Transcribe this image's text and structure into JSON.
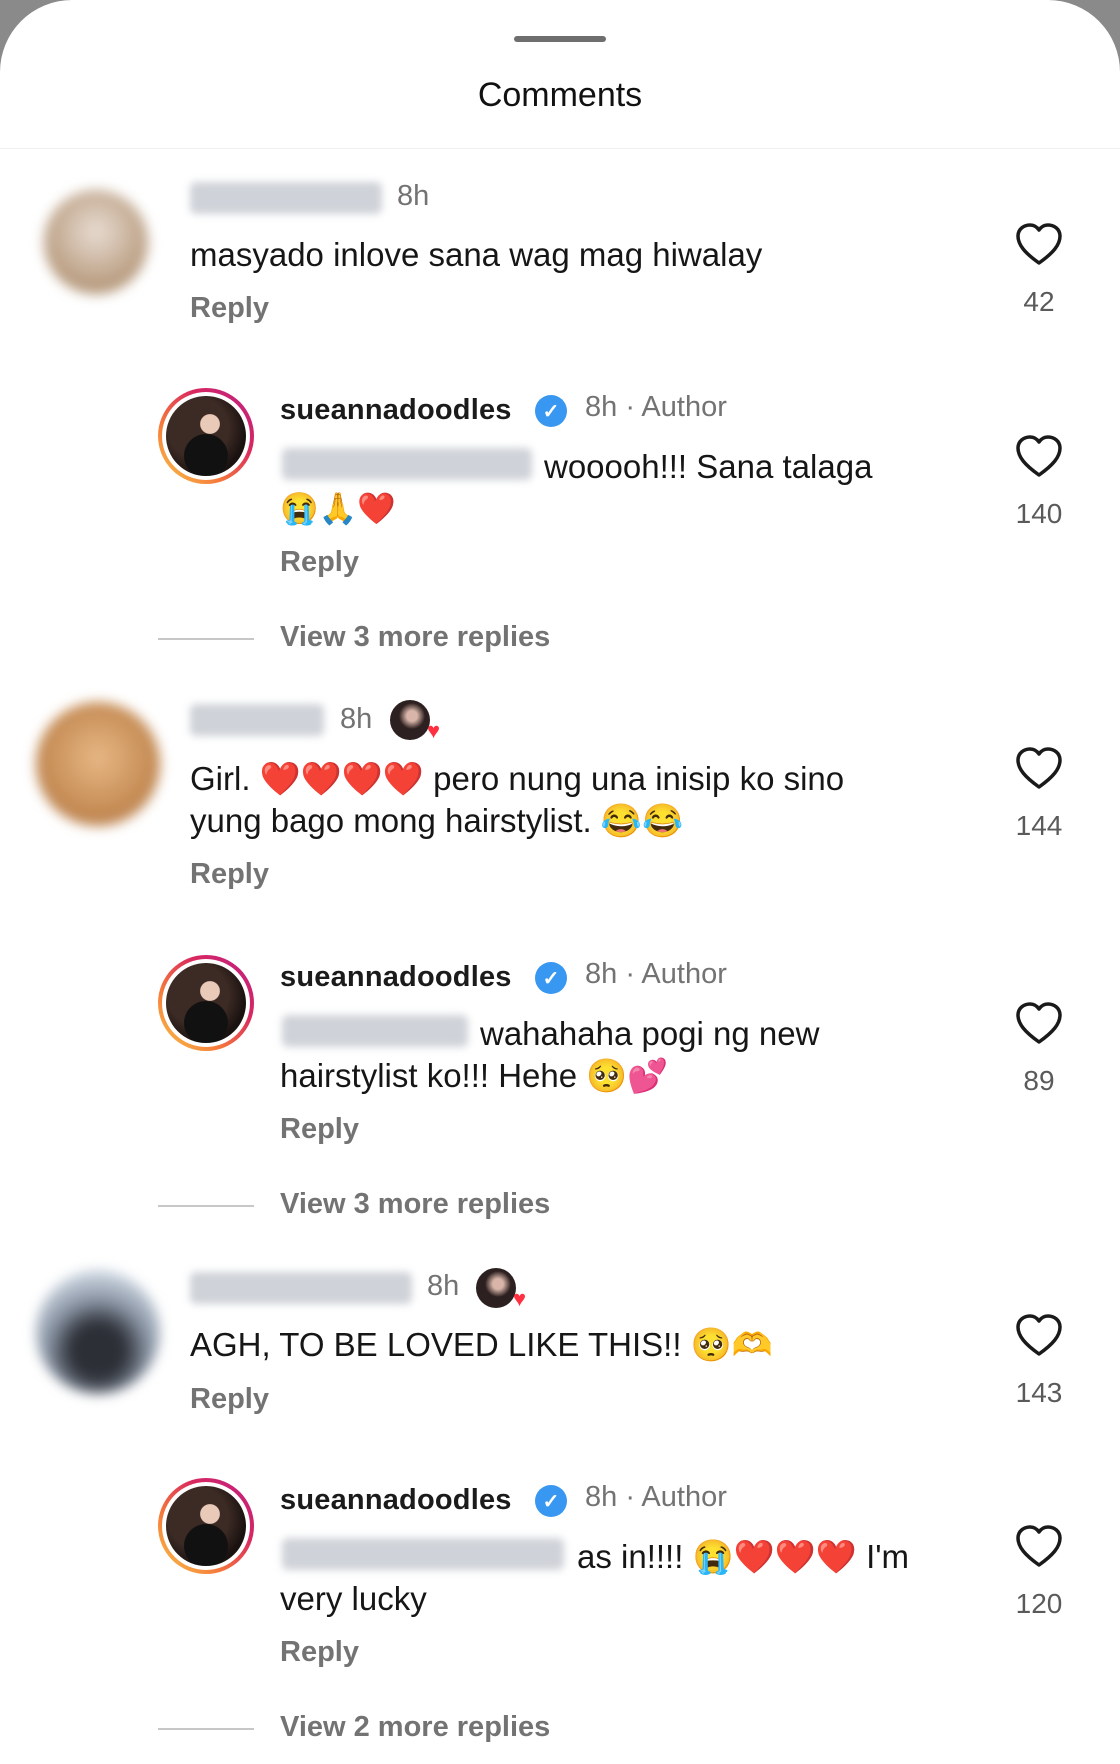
{
  "sheet": {
    "title": "Comments"
  },
  "comments": [
    {
      "time": "8h",
      "text": "masyado inlove sana wag mag hiwalay",
      "reply": "Reply",
      "likes": "42"
    },
    {
      "author": "sueannadoodles",
      "time": "8h · Author",
      "text_line1": "wooooh!!! Sana talaga",
      "text_line2": "😭🙏❤️",
      "reply": "Reply",
      "likes": "140",
      "view_more": "View 3 more replies"
    },
    {
      "time": "8h",
      "text_line1": "Girl. ❤️❤️❤️❤️ pero nung una inisip ko sino",
      "text_line2": "yung bago mong hairstylist. 😂😂",
      "reply": "Reply",
      "likes": "144"
    },
    {
      "author": "sueannadoodles",
      "time": "8h · Author",
      "text_line1": "wahahaha pogi ng new",
      "text_line2": "hairstylist ko!!! Hehe 🥺💕",
      "reply": "Reply",
      "likes": "89",
      "view_more": "View 3 more replies"
    },
    {
      "time": "8h",
      "text": "AGH, TO BE LOVED LIKE THIS!! 🥺🫶",
      "reply": "Reply",
      "likes": "143"
    },
    {
      "author": "sueannadoodles",
      "time": "8h · Author",
      "text_line1": "as in!!!! 😭❤️❤️❤️ I'm",
      "text_line2": "very lucky",
      "reply": "Reply",
      "likes": "120",
      "view_more": "View 2 more replies"
    }
  ],
  "colors": {
    "verified": "#3897f0",
    "heart_badge": "#ff3040",
    "muted_text": "#737373"
  },
  "icons": {
    "like": "heart-outline-icon",
    "verified": "verified-badge-icon",
    "creator_liked": "creator-liked-heart-icon"
  }
}
